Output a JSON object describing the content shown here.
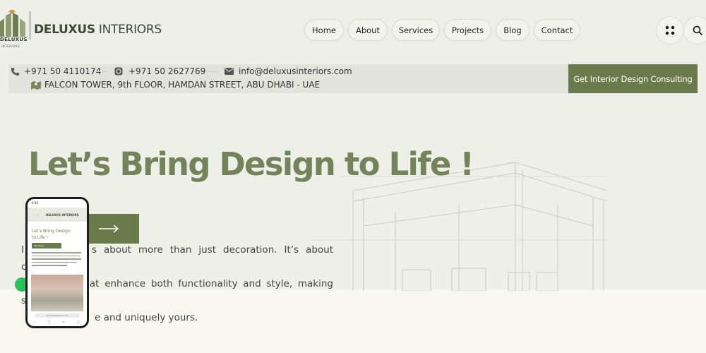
{
  "brand": {
    "name_bold": "DELUXUS",
    "name_rest": " INTERIORS",
    "mark_text": "DELUXUS",
    "mark_sub": "INTERIORS",
    "accent": "#6b7a4b"
  },
  "nav": {
    "items": [
      {
        "label": "Home"
      },
      {
        "label": "About"
      },
      {
        "label": "Services"
      },
      {
        "label": "Projects"
      },
      {
        "label": "Blog"
      },
      {
        "label": "Contact"
      }
    ],
    "menu_icon": "grid-dots-icon",
    "search_icon": "search-icon"
  },
  "contact": {
    "phone": "+971 50 4110174",
    "whatsapp": "+971 50 2627769",
    "email": "info@deluxusinteriors.com",
    "address": "FALCON TOWER, 9th FLOOR, HAMDAN STREET, ABU DHABI - UAE",
    "cta_label": "Get Interior Design Consulting"
  },
  "hero": {
    "title": "Let’s Bring Design to Life !",
    "para_1": "I",
    "para_1b": "s about more than just decoration. It’s about creating",
    "para_2": "e",
    "para_2b": "hat enhance both functionality and style, making spaces",
    "para_3b": "e and uniquely yours.",
    "arrow_icon": "arrow-right-icon"
  },
  "phone_preview": {
    "time": "9:56",
    "brand": "DELUXUS INTERIORS",
    "title": "Let’s Bring Design to Life !",
    "button": "Get Interior",
    "url": "deluxusinteriors.com"
  }
}
